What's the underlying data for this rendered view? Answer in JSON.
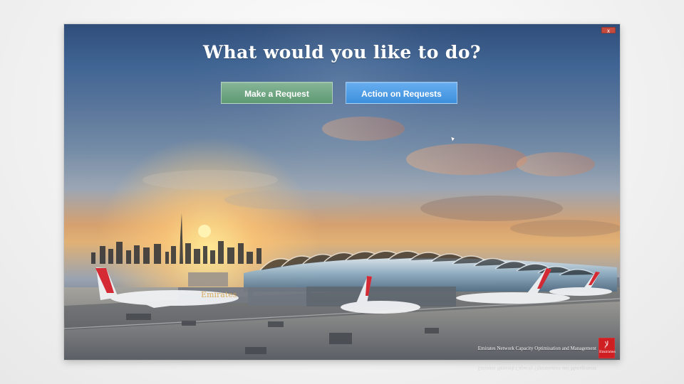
{
  "window": {
    "close_label": "x"
  },
  "hero": {
    "headline": "What would you like to do?"
  },
  "actions": {
    "make_request_label": "Make a Request",
    "action_on_requests_label": "Action on Requests"
  },
  "scene": {
    "aircraft_livery_text": "Emirates"
  },
  "footer": {
    "caption": "Emirates Network Capacity Optimisation and Management",
    "brand_name": "Emirates",
    "brand_symbol": "ﻹ"
  },
  "icons": {
    "close": "close-icon",
    "brand": "emirates-logo-icon",
    "cursor": "mouse-cursor-icon"
  },
  "colors": {
    "make_request_button": "#6ea883",
    "action_on_requests_button": "#4d9be6",
    "close_button": "#c44b3e",
    "brand_red": "#cf1f23"
  }
}
